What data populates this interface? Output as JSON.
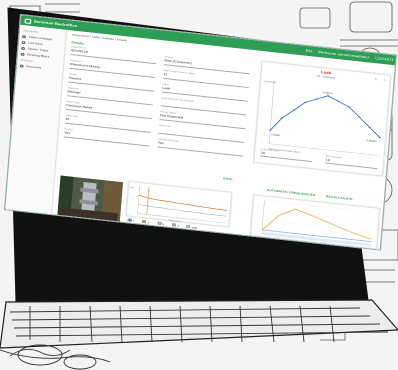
{
  "app": {
    "brand": "Sensmon Backoffice",
    "user_version": "EN",
    "user_greeting": "Welcome sensmonadmin!",
    "logout": "LOGOUT"
  },
  "sidebar": {
    "section1": "Operations",
    "items1": [
      {
        "label": "Valve Leakage",
        "icon": "drop-icon"
      },
      {
        "label": "List View",
        "icon": "list-icon"
      },
      {
        "label": "Steam Traps",
        "icon": "trap-icon"
      },
      {
        "label": "Bearing Black",
        "icon": "bearing-icon"
      }
    ],
    "section2": "Structure",
    "items2": [
      {
        "label": "Accounts",
        "icon": "user-icon"
      }
    ]
  },
  "breadcrumb": "Inspections / Valve Leakage / Details",
  "section_title": "Details",
  "form": {
    "fields": [
      {
        "label": "Inspection ID",
        "value": "SENSE10"
      },
      {
        "label": "Region",
        "value": "Dow (Customer)"
      },
      {
        "label": "Customer",
        "value": "Chemical Industry"
      },
      {
        "label": "Differential Pressure (Bar)",
        "value": "11"
      },
      {
        "label": "Phase",
        "value": "Gasses"
      },
      {
        "label": "Valve",
        "value": "Leak"
      },
      {
        "label": "Inspector",
        "value": "Michael"
      },
      {
        "label": "Leak Rate (l/h) (Estimated)",
        "value": ""
      },
      {
        "label": "Valve Type",
        "value": "Pressure Relief"
      },
      {
        "label": "Repair Status",
        "value": "Not Inspected"
      },
      {
        "label": "Valve Size",
        "value": "15"
      },
      {
        "label": "Valve Info",
        "value": ""
      },
      {
        "label": "Priority",
        "value": "Yes"
      },
      {
        "label": "Priority Inspection",
        "value": "Yes"
      }
    ],
    "save_label": "SAVE"
  },
  "leak_chart": {
    "title": "Leak",
    "subtitle": "(11 - Gasses)",
    "peak_label": "0.0012",
    "low_label": "0.0006",
    "right_label": "0.00004",
    "ylabel": "Leak Rate",
    "xlabel": "Differential Pressure (bar)",
    "nav_prev": "<",
    "nav_next": ">"
  },
  "inputs": [
    {
      "label": "Leak Rate (l/h)",
      "value": "20"
    },
    {
      "label": "Diff. Pressure",
      "value": "13"
    }
  ],
  "actions": {
    "auto_freq": "AUTOMATIC FREQUENCIES",
    "recalculate": "RECALCULATE"
  },
  "legend": [
    {
      "label": "1",
      "color": "#2d6fbf"
    },
    {
      "label": "2",
      "color": "#e8843a"
    },
    {
      "label": "3",
      "color": "#d9d9d9"
    },
    {
      "label": "4",
      "color": "#f2c94c"
    },
    {
      "label": "drift",
      "color": "#ffffff"
    }
  ],
  "chart_data": [
    {
      "type": "line",
      "title": "Leak",
      "subtitle": "(11 - Gasses)",
      "x": [
        0,
        2,
        4,
        6,
        8,
        10,
        12,
        14,
        16,
        18,
        20
      ],
      "y": [
        0.0003,
        0.0006,
        0.0008,
        0.001,
        0.0011,
        0.0012,
        0.0011,
        0.001,
        0.0008,
        0.0006,
        0.0004
      ],
      "color": "#3b6ed4"
    },
    {
      "type": "line",
      "title": "",
      "ylabel": "dB",
      "xlabel": "Frequency",
      "series": [
        {
          "name": "",
          "values": [
            80,
            78,
            76,
            75,
            74,
            74,
            73,
            73,
            72,
            72,
            71,
            71,
            70,
            70,
            69,
            69,
            68,
            68,
            68,
            67
          ],
          "color": "#d35b1c"
        },
        {
          "name": "",
          "values": [
            60,
            59,
            59,
            58,
            58,
            58,
            57,
            57,
            57,
            57,
            56,
            56,
            56,
            56,
            55,
            55,
            55,
            55,
            55,
            55
          ],
          "color": "#9fb2c6"
        }
      ],
      "spike_x": 2
    },
    {
      "type": "line",
      "title": "",
      "x": [
        1,
        2,
        3,
        4,
        5,
        6,
        7,
        8
      ],
      "series": [
        {
          "name": "",
          "values": [
            0,
            55,
            82,
            68,
            52,
            35,
            20,
            8
          ],
          "color": "#f2a541"
        },
        {
          "name": "",
          "values": [
            0,
            0,
            0,
            0,
            0,
            0,
            0,
            0
          ],
          "color": "#87b7e6"
        }
      ]
    }
  ]
}
